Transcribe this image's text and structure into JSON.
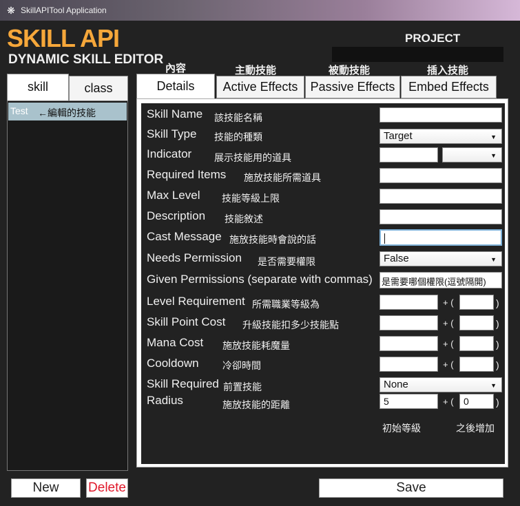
{
  "window": {
    "title": "SkillAPITool Application",
    "icon": "gear-icon"
  },
  "header": {
    "app_name": "SKILL API",
    "subtitle": "DYNAMIC SKILL EDITOR",
    "project_dir_label": "PROJECT DIRECTORY",
    "project_dir_value": ""
  },
  "sidebar": {
    "tabs": [
      {
        "label": "skill",
        "active": true
      },
      {
        "label": "class",
        "active": false
      }
    ],
    "items": [
      {
        "name": "Test",
        "note": "←編輯的技能",
        "selected": true
      }
    ]
  },
  "main_tabs": [
    {
      "label": "Details",
      "cn": "內容",
      "active": true
    },
    {
      "label": "Active Effects",
      "cn": "主動技能",
      "active": false
    },
    {
      "label": "Passive Effects",
      "cn": "被動技能",
      "active": false
    },
    {
      "label": "Embed Effects",
      "cn": "插入技能",
      "active": false
    }
  ],
  "fields": {
    "skill_name": {
      "label": "Skill Name",
      "cn": "該技能名稱",
      "value": ""
    },
    "skill_type": {
      "label": "Skill Type",
      "cn": "技能的種類",
      "value": "Target"
    },
    "indicator": {
      "label": "Indicator",
      "cn": "展示技能用的道具",
      "value": "",
      "select": ""
    },
    "required_items": {
      "label": "Required Items",
      "cn": "施放技能所需道具",
      "value": ""
    },
    "max_level": {
      "label": "Max Level",
      "cn": "技能等級上限",
      "value": ""
    },
    "description": {
      "label": "Description",
      "cn": "技能敘述",
      "value": ""
    },
    "cast_message": {
      "label": "Cast Message",
      "cn": "施放技能時會說的話",
      "value": ""
    },
    "needs_permission": {
      "label": "Needs Permission",
      "cn": "是否需要權限",
      "value": "False"
    },
    "given_permissions": {
      "label": "Given Permissions (separate with commas)",
      "value": "是需要哪個權限(逗號隔開)"
    },
    "level_requirement": {
      "label": "Level Requirement",
      "cn": "所需職業等級為",
      "base": "",
      "scale": ""
    },
    "skill_point_cost": {
      "label": "Skill Point Cost",
      "cn": "升級技能扣多少技能點",
      "base": "",
      "scale": ""
    },
    "mana_cost": {
      "label": "Mana Cost",
      "cn": "施放技能耗魔量",
      "base": "",
      "scale": ""
    },
    "cooldown": {
      "label": "Cooldown",
      "cn": "冷卻時間",
      "base": "",
      "scale": ""
    },
    "skill_required": {
      "label": "Skill Required",
      "cn": "前置技能",
      "value": "None"
    },
    "radius": {
      "label": "Radius",
      "cn": "施放技能的距離",
      "base": "5",
      "scale": "0"
    }
  },
  "scaling": {
    "plus": "+ (",
    "close": ")",
    "base_label": "初始等級",
    "scale_label": "之後增加"
  },
  "buttons": {
    "new": "New",
    "delete": "Delete",
    "save": "Save"
  },
  "colors": {
    "brand": "#f6a73a",
    "delete": "#e0182a",
    "selected": "#a9c2cc",
    "focus": "#7fb2d8"
  }
}
